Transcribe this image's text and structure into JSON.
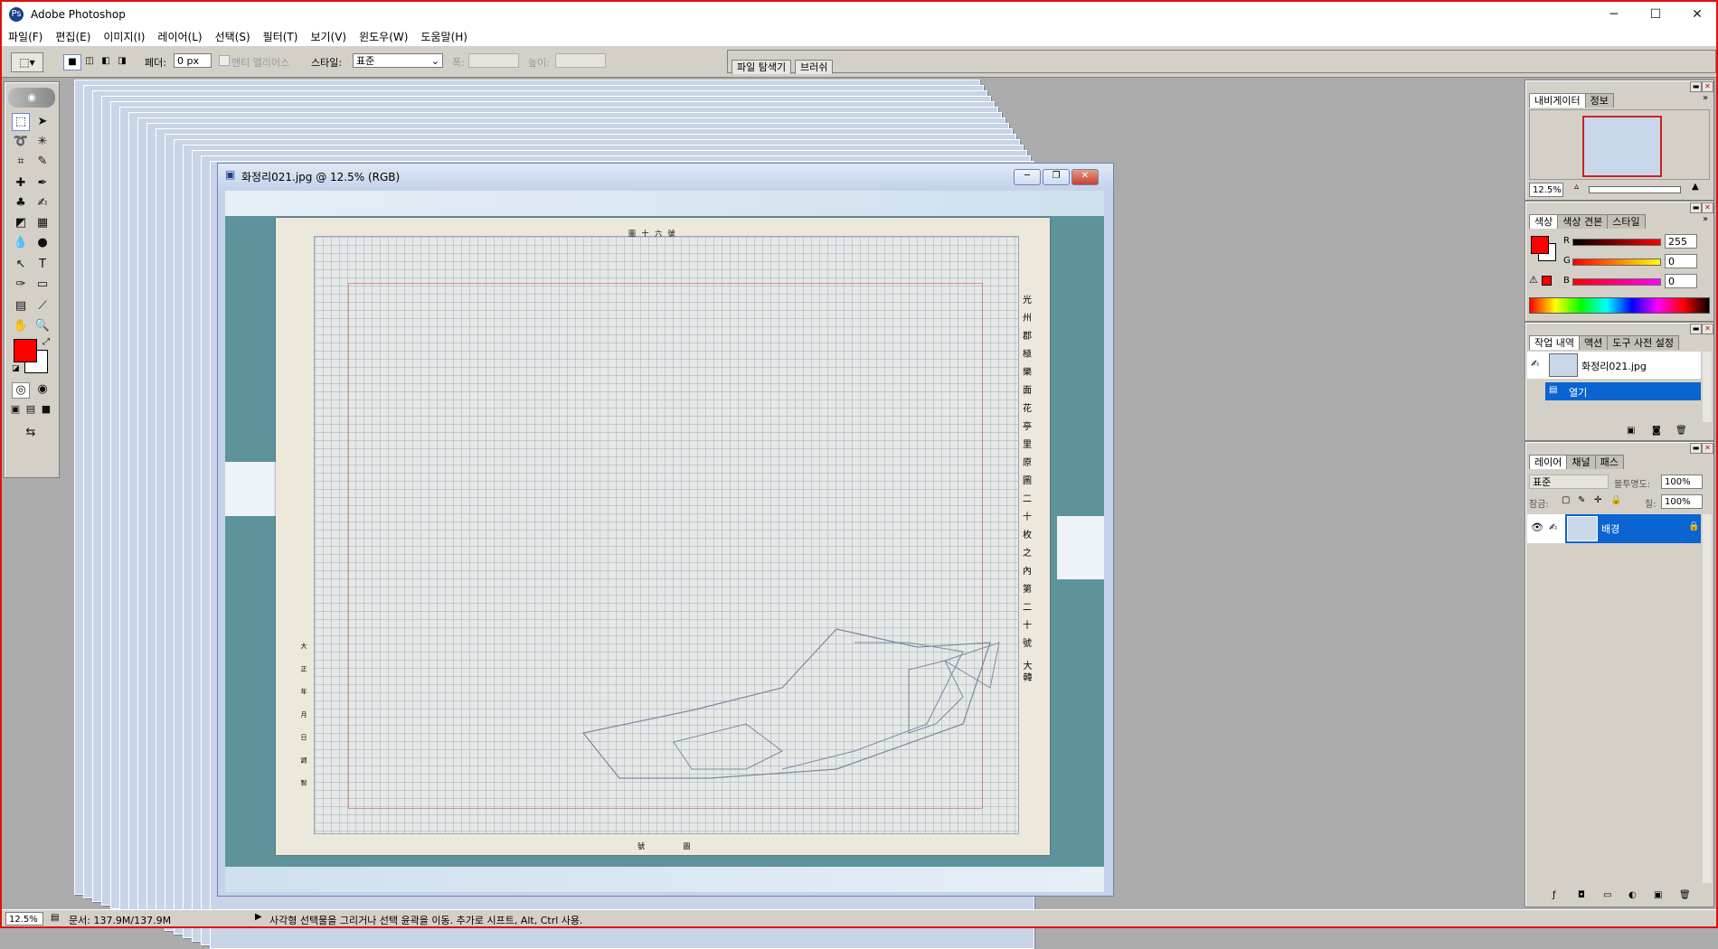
{
  "window": {
    "title": "Adobe Photoshop",
    "minimize": "─",
    "maximize": "☐",
    "close": "✕"
  },
  "menu": [
    "파일(F)",
    "편집(E)",
    "이미지(I)",
    "레이어(L)",
    "선택(S)",
    "필터(T)",
    "보기(V)",
    "윈도우(W)",
    "도움말(H)"
  ],
  "options": {
    "feather_label": "페더:",
    "feather_value": "0 px",
    "antialias_label": "앤티 앨리어스",
    "style_label": "스타일:",
    "style_value": "표준",
    "width_label": "폭:",
    "height_label": "높이:",
    "palette_well_tabs": [
      "파일 탐색기",
      "브러쉬"
    ]
  },
  "colors": {
    "foreground": "#ff0000",
    "background": "#ffffff",
    "accent_selection": "#0a64d2"
  },
  "document": {
    "title": "화정리021.jpg @ 12.5% (RGB)"
  },
  "navigator": {
    "tabs": [
      "내비게이터",
      "정보"
    ],
    "zoom": "12.5%"
  },
  "color_panel": {
    "tabs": [
      "색상",
      "색상 견본",
      "스타일"
    ],
    "r_label": "R",
    "g_label": "G",
    "b_label": "B",
    "r": "255",
    "g": "0",
    "b": "0"
  },
  "history": {
    "tabs": [
      "작업 내역",
      "액션",
      "도구 사전 설정"
    ],
    "snapshot": "화정리021.jpg",
    "step": "열기"
  },
  "layers": {
    "tabs": [
      "레이어",
      "채널",
      "패스"
    ],
    "blend_mode": "표준",
    "opacity_label": "불투명도:",
    "opacity": "100%",
    "lock_label": "잠금:",
    "fill_label": "칠:",
    "fill": "100%",
    "layer_name": "배경"
  },
  "status": {
    "zoom": "12.5%",
    "doc_size": "문서: 137.9M/137.9M",
    "hint": "사각형 선택물을 그리거나 선택 윤곽을 이동. 추가로 시프트, Alt, Ctrl 사용."
  },
  "map_text": {
    "top_label": "圖 十 六 號",
    "right_column": [
      "光",
      "州",
      "郡",
      "極",
      "樂",
      "面",
      "花",
      "亭",
      "里",
      "原",
      "圖",
      "二",
      "十",
      "枚",
      "之",
      "內",
      "第",
      "二",
      "十",
      "號"
    ],
    "right_bottom": "大 韓",
    "left_label": "大 正 年 月 日 調 製",
    "bottom_label": "號 圖"
  }
}
